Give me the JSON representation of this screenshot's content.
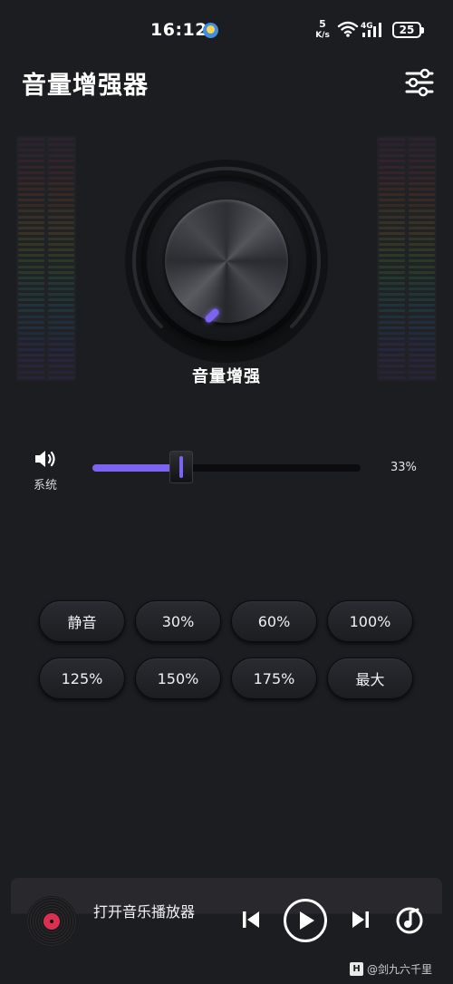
{
  "status_bar": {
    "time": "16:12",
    "net_speed_value": "5",
    "net_speed_unit": "K/s",
    "network_type": "4G",
    "battery": "25",
    "icons": [
      "weather-icon",
      "wifi-icon",
      "signal-icon",
      "battery-icon"
    ]
  },
  "header": {
    "title": "音量增强器",
    "settings_icon": "sliders-icon"
  },
  "knob": {
    "label": "音量增强",
    "accent_color": "#7d63f2"
  },
  "system_volume": {
    "label": "系统",
    "icon": "speaker-icon",
    "value_percent": 33,
    "value_label": "33%"
  },
  "presets": [
    "静音",
    "30%",
    "60%",
    "100%",
    "125%",
    "150%",
    "175%",
    "最大"
  ],
  "player": {
    "title": "打开音乐播放器",
    "icons": [
      "vinyl-icon",
      "previous-icon",
      "play-icon",
      "next-icon",
      "music-note-icon"
    ]
  },
  "watermark": {
    "logo": "H",
    "text": "@剑九六千里"
  },
  "colors": {
    "background": "#1c1d21",
    "accent": "#7d63f2"
  }
}
